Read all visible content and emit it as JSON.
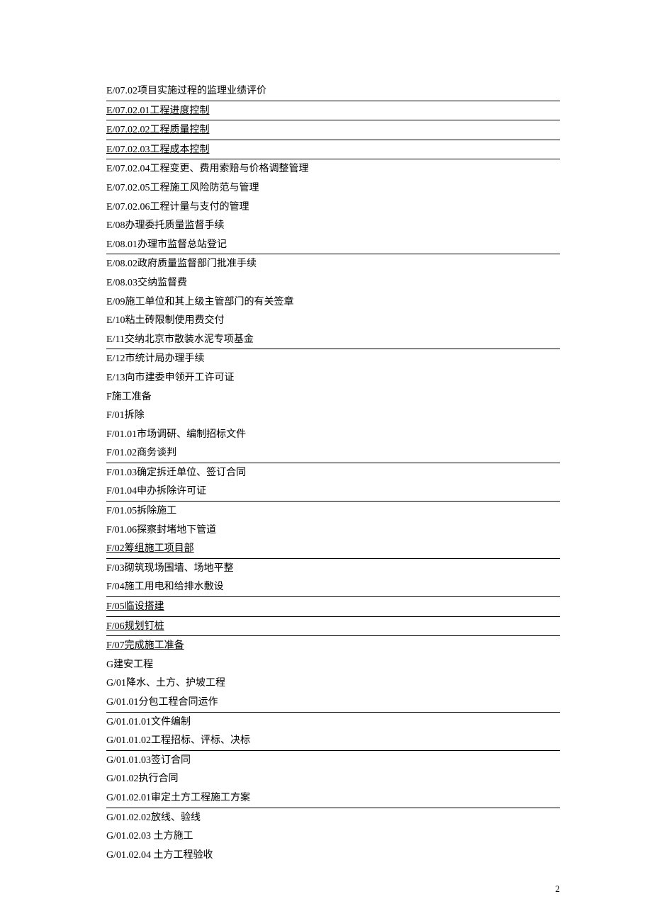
{
  "lines": [
    {
      "text": "E/07.02项目实施过程的监理业绩评价",
      "border": true,
      "underline": false
    },
    {
      "text": "E/07.02.01工程进度控制",
      "border": true,
      "underline": true
    },
    {
      "text": "E/07.02.02工程质量控制",
      "border": true,
      "underline": true
    },
    {
      "text": "E/07.02.03工程成本控制",
      "border": true,
      "underline": true
    },
    {
      "text": "E/07.02.04工程变更、费用索赔与价格调整管理",
      "border": false,
      "underline": false
    },
    {
      "text": "E/07.02.05工程施工风险防范与管理",
      "border": false,
      "underline": false
    },
    {
      "text": "E/07.02.06工程计量与支付的管理",
      "border": false,
      "underline": false
    },
    {
      "text": "E/08办理委托质量监督手续",
      "border": false,
      "underline": false
    },
    {
      "text": "E/08.01办理市监督总站登记",
      "border": true,
      "underline": false
    },
    {
      "text": "E/08.02政府质量监督部门批准手续",
      "border": false,
      "underline": false
    },
    {
      "text": "E/08.03交纳监督费",
      "border": false,
      "underline": false
    },
    {
      "text": "E/09施工单位和其上级主管部门的有关签章",
      "border": false,
      "underline": false
    },
    {
      "text": "E/10粘土砖限制使用费交付",
      "border": false,
      "underline": false
    },
    {
      "text": "E/11交纳北京市散装水泥专项基金",
      "border": true,
      "underline": false
    },
    {
      "text": "E/12市统计局办理手续",
      "border": false,
      "underline": false
    },
    {
      "text": "E/13向市建委申领开工许可证",
      "border": false,
      "underline": false
    },
    {
      "text": "F施工准备",
      "border": false,
      "underline": false
    },
    {
      "text": "F/01拆除",
      "border": false,
      "underline": false
    },
    {
      "text": "F/01.01市场调研、编制招标文件",
      "border": false,
      "underline": false
    },
    {
      "text": "F/01.02商务谈判",
      "border": true,
      "underline": false
    },
    {
      "text": "F/01.03确定拆迁单位、签订合同",
      "border": false,
      "underline": false
    },
    {
      "text": "F/01.04申办拆除许可证",
      "border": true,
      "underline": false
    },
    {
      "text": "F/01.05拆除施工",
      "border": false,
      "underline": false
    },
    {
      "text": "F/01.06探察封堵地下管道",
      "border": false,
      "underline": false
    },
    {
      "text": "F/02筹组施工项目部",
      "border": true,
      "underline": true
    },
    {
      "text": "F/03砌筑现场围墙、场地平整",
      "border": false,
      "underline": false
    },
    {
      "text": "F/04施工用电和给排水敷设",
      "border": true,
      "underline": false
    },
    {
      "text": "F/05临设搭建",
      "border": true,
      "underline": true
    },
    {
      "text": "F/06规划钉桩",
      "border": true,
      "underline": true
    },
    {
      "text": "F/07完成施工准备",
      "border": false,
      "underline": true
    },
    {
      "text": "G建安工程",
      "border": false,
      "underline": false
    },
    {
      "text": "G/01降水、土方、护坡工程",
      "border": false,
      "underline": false
    },
    {
      "text": "G/01.01分包工程合同运作",
      "border": true,
      "underline": false
    },
    {
      "text": "G/01.01.01文件编制",
      "border": false,
      "underline": false
    },
    {
      "text": "G/01.01.02工程招标、评标、决标",
      "border": true,
      "underline": false
    },
    {
      "text": "G/01.01.03签订合同",
      "border": false,
      "underline": false
    },
    {
      "text": "G/01.02执行合同",
      "border": false,
      "underline": false
    },
    {
      "text": "G/01.02.01审定土方工程施工方案",
      "border": true,
      "underline": false
    },
    {
      "text": "G/01.02.02放线、验线",
      "border": false,
      "underline": false
    },
    {
      "text": "G/01.02.03 土方施工",
      "border": false,
      "underline": false
    },
    {
      "text": "G/01.02.04 土方工程验收",
      "border": false,
      "underline": false
    }
  ],
  "page_number": "2"
}
